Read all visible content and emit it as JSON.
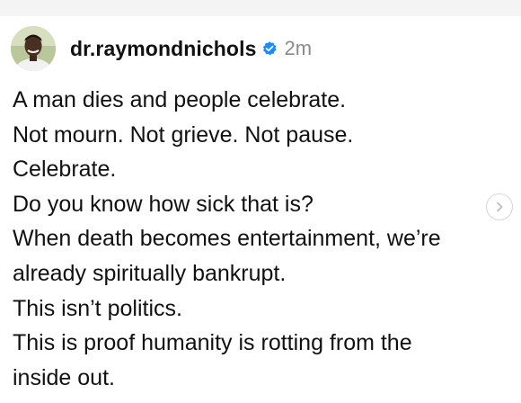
{
  "post": {
    "username": "dr.raymondnichols",
    "timestamp": "2m",
    "verified": true,
    "lines": [
      "A man dies and people celebrate.",
      "Not mourn. Not grieve. Not pause.",
      "Celebrate.",
      "Do you know how sick that is?",
      "When death becomes entertainment, we’re",
      "already spiritually bankrupt.",
      "This isn’t politics.",
      "This is proof humanity is rotting from the",
      "inside out."
    ]
  },
  "icons": {
    "avatar": "user-avatar-photo",
    "verified": "verified-badge-icon",
    "next": "chevron-right-icon"
  },
  "colors": {
    "verified_blue": "#1d8cf8",
    "timestamp_gray": "#8a8a8a",
    "text": "#111111"
  }
}
